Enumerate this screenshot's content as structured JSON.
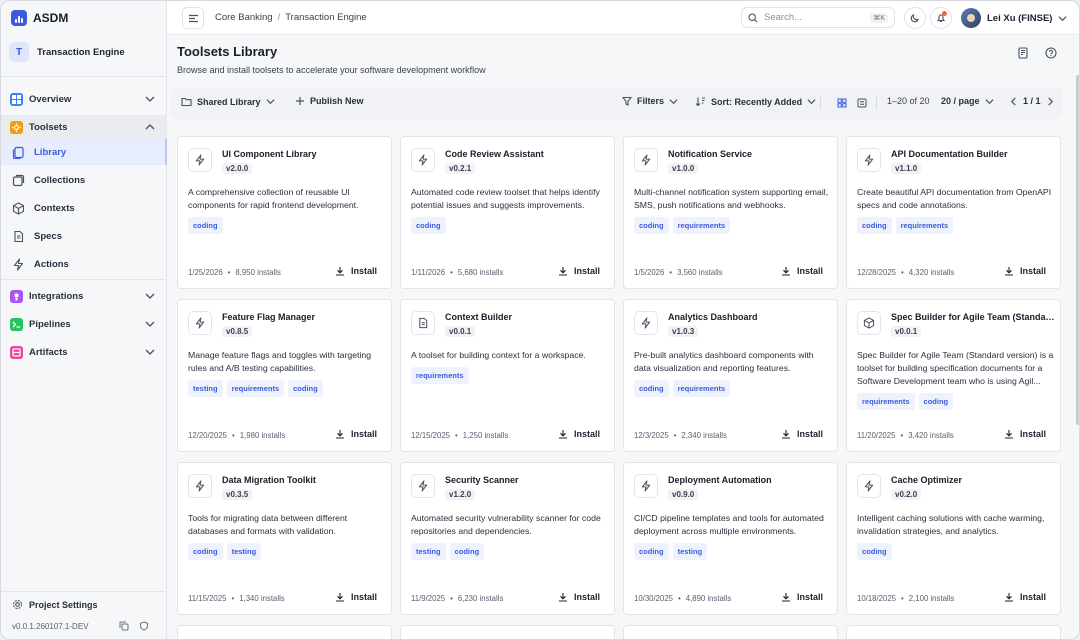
{
  "brand": {
    "name": "ASDM",
    "accent": "#3b5bdb"
  },
  "project": {
    "initial": "T",
    "name": "Transaction Engine"
  },
  "nav": {
    "overview": {
      "label": "Overview",
      "color": "#3b82f6"
    },
    "toolsets": {
      "label": "Toolsets",
      "color": "#f59e0b"
    },
    "sub": [
      {
        "label": "Library",
        "icon": "library-icon"
      },
      {
        "label": "Collections",
        "icon": "collections-icon"
      },
      {
        "label": "Contexts",
        "icon": "cube-icon"
      },
      {
        "label": "Specs",
        "icon": "document-icon"
      },
      {
        "label": "Actions",
        "icon": "lightning-icon"
      }
    ],
    "integrations": {
      "label": "Integrations",
      "color": "#a855f7"
    },
    "pipelines": {
      "label": "Pipelines",
      "color": "#22c55e"
    },
    "artifacts": {
      "label": "Artifacts",
      "color": "#ec4899"
    }
  },
  "sidebar_footer": {
    "settings_label": "Project Settings",
    "version": "v0.0.1.260107.1-DEV"
  },
  "topbar": {
    "breadcrumb": [
      "Core Banking",
      "Transaction Engine"
    ],
    "search_placeholder": "Search...",
    "search_shortcut": "⌘K",
    "user_name": "Lei Xu (FINSE)"
  },
  "page": {
    "title": "Toolsets Library",
    "subtitle": "Browse and install toolsets to accelerate your software development workflow"
  },
  "toolbar": {
    "library_label": "Shared Library",
    "publish_label": "Publish New",
    "filters_label": "Filters",
    "sort_label": "Sort: Recently Added",
    "range": "1–20 of 20",
    "per_page": "20 / page",
    "page": "1 / 1"
  },
  "install_label": "Install",
  "cards": [
    {
      "name": "UI Component Library",
      "version": "v2.0.0",
      "icon": "lightning-icon",
      "desc": "A comprehensive collection of reusable UI components for rapid frontend development.",
      "tags": [
        "coding"
      ],
      "date": "1/25/2026",
      "installs": "8,950 installs"
    },
    {
      "name": "Code Review Assistant",
      "version": "v0.2.1",
      "icon": "lightning-icon",
      "desc": "Automated code review toolset that helps identify potential issues and suggests improvements.",
      "tags": [
        "coding"
      ],
      "date": "1/11/2026",
      "installs": "5,680 installs"
    },
    {
      "name": "Notification Service",
      "version": "v1.0.0",
      "icon": "lightning-icon",
      "desc": "Multi-channel notification system supporting email, SMS, push notifications and webhooks.",
      "tags": [
        "coding",
        "requirements"
      ],
      "date": "1/5/2026",
      "installs": "3,560 installs"
    },
    {
      "name": "API Documentation Builder",
      "version": "v1.1.0",
      "icon": "lightning-icon",
      "desc": "Create beautiful API documentation from OpenAPI specs and code annotations.",
      "tags": [
        "coding",
        "requirements"
      ],
      "date": "12/28/2025",
      "installs": "4,320 installs"
    },
    {
      "name": "Feature Flag Manager",
      "version": "v0.8.5",
      "icon": "lightning-icon",
      "desc": "Manage feature flags and toggles with targeting rules and A/B testing capabilities.",
      "tags": [
        "testing",
        "requirements",
        "coding"
      ],
      "date": "12/20/2025",
      "installs": "1,980 installs"
    },
    {
      "name": "Context Builder",
      "version": "v0.0.1",
      "icon": "document-icon",
      "desc": "A toolset for building context for a workspace.",
      "tags": [
        "requirements"
      ],
      "date": "12/15/2025",
      "installs": "1,250 installs"
    },
    {
      "name": "Analytics Dashboard",
      "version": "v1.0.3",
      "icon": "lightning-icon",
      "desc": "Pre-built analytics dashboard components with data visualization and reporting features.",
      "tags": [
        "coding",
        "requirements"
      ],
      "date": "12/3/2025",
      "installs": "2,340 installs"
    },
    {
      "name": "Spec Builder for Agile Team (Standard...",
      "version": "v0.0.1",
      "icon": "cube-icon",
      "desc": "Spec Builder for Agile Team (Standard version) is a toolset for building specification documents for a Software Development team who is using Agil...",
      "tags": [
        "requirements",
        "coding"
      ],
      "date": "11/20/2025",
      "installs": "3,420 installs"
    },
    {
      "name": "Data Migration Toolkit",
      "version": "v0.3.5",
      "icon": "lightning-icon",
      "desc": "Tools for migrating data between different databases and formats with validation.",
      "tags": [
        "coding",
        "testing"
      ],
      "date": "11/15/2025",
      "installs": "1,340 installs"
    },
    {
      "name": "Security Scanner",
      "version": "v1.2.0",
      "icon": "lightning-icon",
      "desc": "Automated security vulnerability scanner for code repositories and dependencies.",
      "tags": [
        "testing",
        "coding"
      ],
      "date": "11/9/2025",
      "installs": "6,230 installs"
    },
    {
      "name": "Deployment Automation",
      "version": "v0.9.0",
      "icon": "lightning-icon",
      "desc": "CI/CD pipeline templates and tools for automated deployment across multiple environments.",
      "tags": [
        "coding",
        "testing"
      ],
      "date": "10/30/2025",
      "installs": "4,890 installs"
    },
    {
      "name": "Cache Optimizer",
      "version": "v0.2.0",
      "icon": "lightning-icon",
      "desc": "Intelligent caching solutions with cache warming, invalidation strategies, and analytics.",
      "tags": [
        "coding"
      ],
      "date": "10/18/2025",
      "installs": "2,100 installs"
    }
  ]
}
